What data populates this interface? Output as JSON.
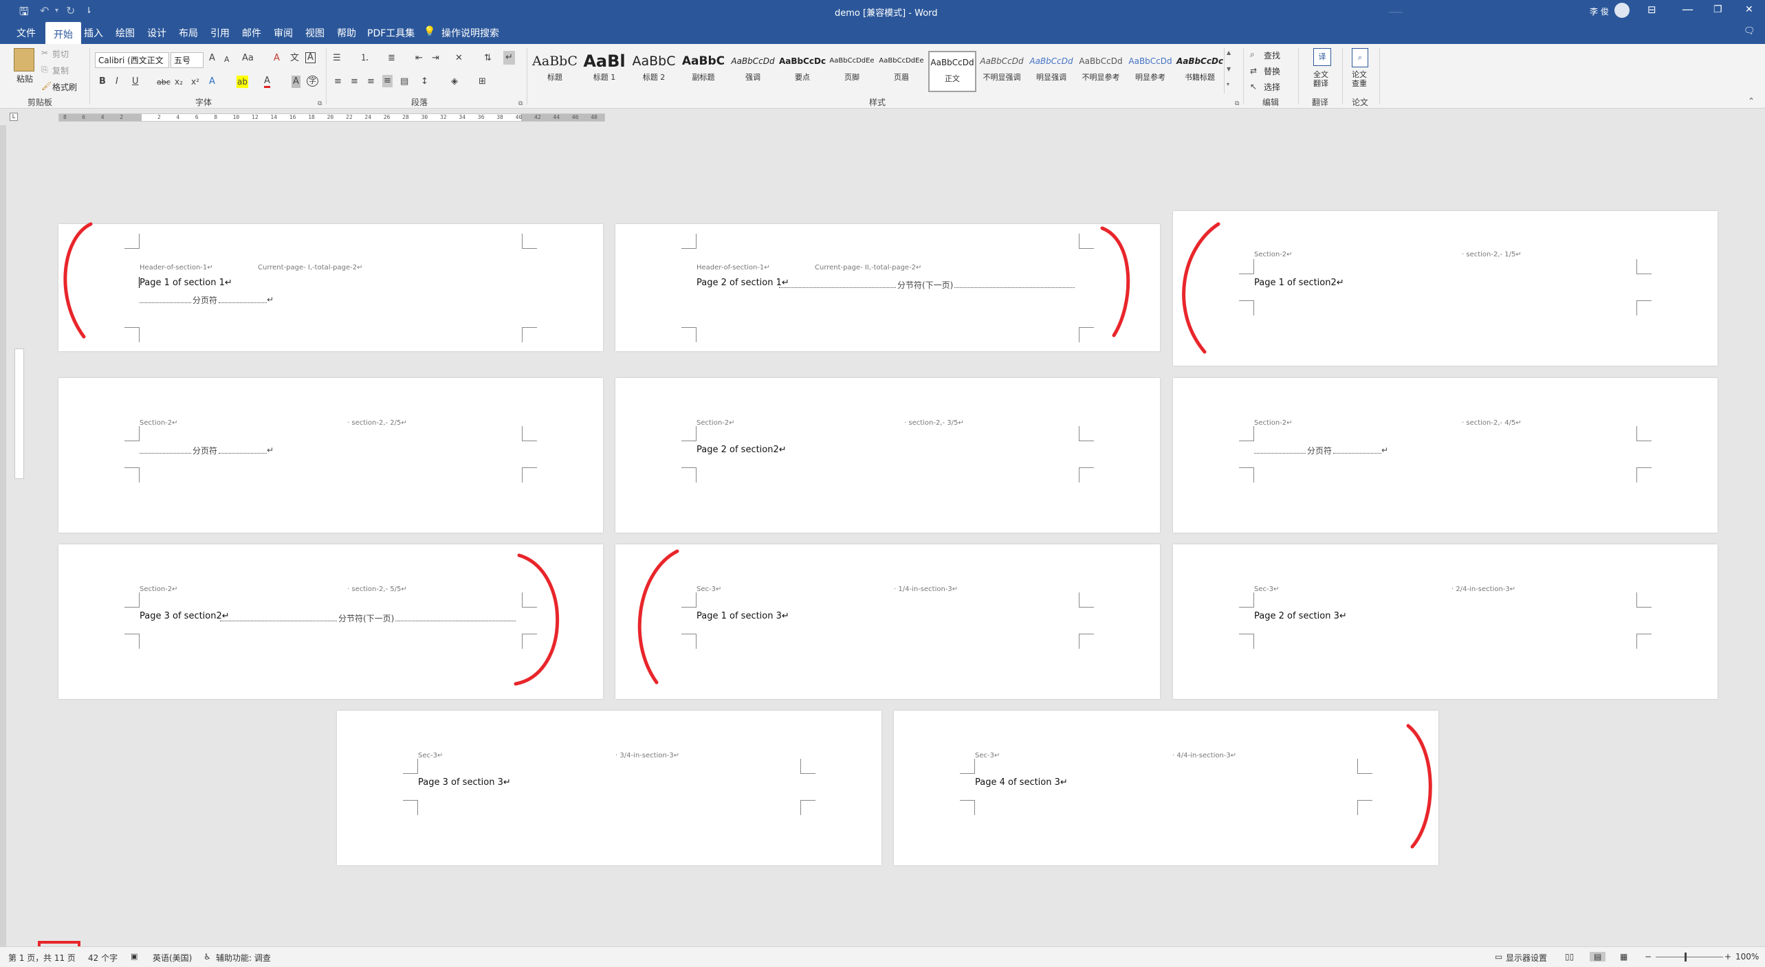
{
  "titlebar": {
    "doc_title": "demo [兼容模式] - Word",
    "user_name": "李 俊",
    "qa_undo_more": "▾",
    "customize": "⇂",
    "minimize": "—",
    "restore": "❐",
    "close": "✕"
  },
  "tabs": {
    "file": "文件",
    "home": "开始",
    "insert": "插入",
    "draw": "绘图",
    "design": "设计",
    "layout": "布局",
    "references": "引用",
    "mailings": "邮件",
    "review": "审阅",
    "view": "视图",
    "help": "帮助",
    "pdf": "PDF工具集",
    "tell_me": "操作说明搜索"
  },
  "ribbon": {
    "clipboard": {
      "paste": "粘贴",
      "cut": "剪切",
      "copy": "复制",
      "format_painter": "格式刷",
      "label": "剪贴板"
    },
    "font": {
      "name": "Calibri (西文正文",
      "size": "五号",
      "grow": "A",
      "shrink": "A",
      "case": "Aa",
      "clear": "A",
      "pinyin": "文",
      "border": "A",
      "bold": "B",
      "italic": "I",
      "underline": "U",
      "strike": "abc",
      "sub": "x₂",
      "sup": "x²",
      "effects": "A",
      "highlight": "ab",
      "color": "A",
      "shade": "A",
      "circle": "字",
      "label": "字体"
    },
    "paragraph": {
      "label": "段落"
    },
    "styles": {
      "label": "样式",
      "items": [
        {
          "sample": "AaBbC",
          "name": "标题"
        },
        {
          "sample": "AaBl",
          "name": "标题 1"
        },
        {
          "sample": "AaBbC",
          "name": "标题 2"
        },
        {
          "sample": "AaBbC",
          "name": "副标题"
        },
        {
          "sample": "AaBbCcDd",
          "name": "强调"
        },
        {
          "sample": "AaBbCcDc",
          "name": "要点"
        },
        {
          "sample": "AaBbCcDdEe",
          "name": "页脚"
        },
        {
          "sample": "AaBbCcDdEe",
          "name": "页眉"
        },
        {
          "sample": "AaBbCcDd",
          "name": "正文"
        },
        {
          "sample": "AaBbCcDd",
          "name": "不明显强调"
        },
        {
          "sample": "AaBbCcDd",
          "name": "明显强调"
        },
        {
          "sample": "AaBbCcDd",
          "name": "不明显参考"
        },
        {
          "sample": "AaBbCcDd",
          "name": "明显参考"
        },
        {
          "sample": "AaBbCcDc",
          "name": "书籍标题"
        }
      ]
    },
    "editing": {
      "find": "查找",
      "replace": "替换",
      "select": "选择",
      "label": "编辑"
    },
    "translate": {
      "full": "全文\n翻译",
      "label": "翻译"
    },
    "paper": {
      "check": "论文\n查重",
      "label": "论文"
    }
  },
  "ruler": {
    "numbers": [
      "8",
      "6",
      "4",
      "2",
      "",
      "2",
      "4",
      "6",
      "8",
      "10",
      "12",
      "14",
      "16",
      "18",
      "20",
      "22",
      "24",
      "26",
      "28",
      "30",
      "32",
      "34",
      "36",
      "38",
      "40",
      "42",
      "44",
      "46",
      "48"
    ]
  },
  "pages": [
    {
      "header_left": "Header-of-section-1↵",
      "header_right": "Current-page- I,-total-page-2↵",
      "body": "Page 1 of section 1↵",
      "break": "分页符",
      "break_type": "short"
    },
    {
      "header_left": "Header-of-section-1↵",
      "header_right": "Current-page- II,-total-page-2↵",
      "body": "Page 2 of section 1↵",
      "break": "分节符(下一页)",
      "break_type": "long"
    },
    {
      "header_left": "Section-2↵",
      "header_right": "· section-2,- 1/5↵",
      "body": "Page 1 of section2↵",
      "break": "",
      "break_type": "none"
    },
    {
      "header_left": "Section-2↵",
      "header_right": "· section-2,- 2/5↵",
      "body": "",
      "break": "分页符",
      "break_type": "short"
    },
    {
      "header_left": "Section-2↵",
      "header_right": "· section-2,- 3/5↵",
      "body": "Page 2 of section2↵",
      "break": "",
      "break_type": "none"
    },
    {
      "header_left": "Section-2↵",
      "header_right": "· section-2,- 4/5↵",
      "body": "",
      "break": "分页符",
      "break_type": "short"
    },
    {
      "header_left": "Section-2↵",
      "header_right": "· section-2,- 5/5↵",
      "body": "Page 3 of section2↵",
      "break": "分节符(下一页)",
      "break_type": "long"
    },
    {
      "header_left": "Sec-3↵",
      "header_right": "· 1/4-in-section-3↵",
      "body": "Page 1 of section 3↵",
      "break": "",
      "break_type": "none"
    },
    {
      "header_left": "Sec-3↵",
      "header_right": "· 2/4-in-section-3↵",
      "body": "Page 2 of section 3↵",
      "break": "",
      "break_type": "none"
    },
    {
      "header_left": "Sec-3↵",
      "header_right": "· 3/4-in-section-3↵",
      "body": "Page 3 of section 3↵",
      "break": "",
      "break_type": "none"
    },
    {
      "header_left": "Sec-3↵",
      "header_right": "· 4/4-in-section-3↵",
      "body": "Page 4 of section 3↵",
      "break": "",
      "break_type": "none"
    }
  ],
  "status": {
    "page": "第 1 页，",
    "total": "共 11 页",
    "words": "42 个字",
    "language": "英语(美国)",
    "accessibility": "辅助功能: 调查",
    "display_settings": "显示器设置",
    "zoom": "100%"
  },
  "colors": {
    "brand": "#2b579a",
    "annotation": "#e8262b"
  }
}
